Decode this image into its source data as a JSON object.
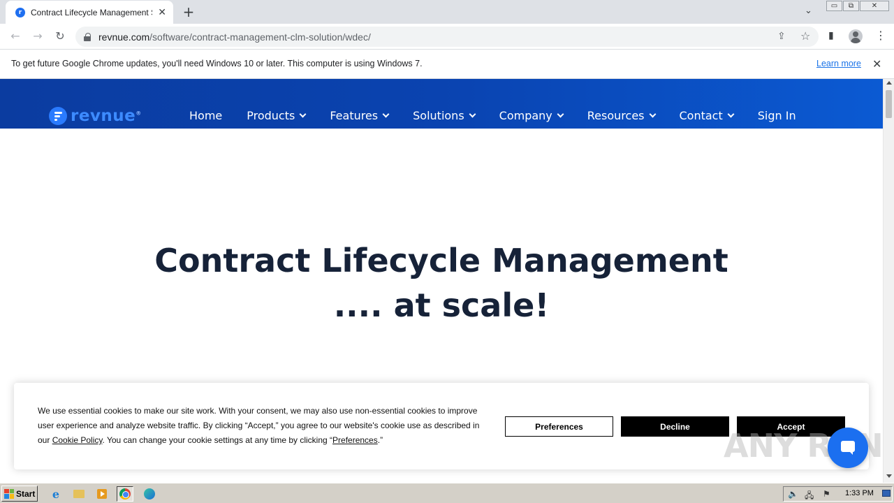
{
  "browser": {
    "tab_title": "Contract Lifecycle Management Soft",
    "favicon_glyph": "r",
    "new_tab_glyph": "+",
    "tab_close_glyph": "✕",
    "tab_search_glyph": "⌄",
    "window_controls": [
      "▭",
      "⧉",
      "✕"
    ],
    "url_host": "revnue.com",
    "url_path": "/software/contract-management-clm-solution/wdec/",
    "back_glyph": "←",
    "forward_glyph": "→",
    "reload_glyph": "↻",
    "share_glyph": "⇪",
    "star_glyph": "☆",
    "sidepanel_glyph": "▮",
    "menu_glyph": "⋮"
  },
  "infobar": {
    "message": "To get future Google Chrome updates, you'll need Windows 10 or later. This computer is using Windows 7.",
    "link": "Learn more",
    "close_glyph": "✕"
  },
  "site": {
    "logo_text": "revnue",
    "logo_mark": "®",
    "nav": [
      {
        "label": "Home",
        "dropdown": false
      },
      {
        "label": "Products",
        "dropdown": true
      },
      {
        "label": "Features",
        "dropdown": true
      },
      {
        "label": "Solutions",
        "dropdown": true
      },
      {
        "label": "Company",
        "dropdown": true
      },
      {
        "label": "Resources",
        "dropdown": true
      },
      {
        "label": "Contact",
        "dropdown": true
      },
      {
        "label": "Sign In",
        "dropdown": false
      }
    ],
    "hero_line1": "Contract Lifecycle Management",
    "hero_line2": ".... at scale!"
  },
  "cookie": {
    "text_1": "We use essential cookies to make our site work. With your consent, we may also use non-essential cookies to improve user experience and analyze website traffic. By clicking “Accept,” you agree to our website's cookie use as described in our ",
    "policy_link": "Cookie Policy",
    "text_2": ". You can change your cookie settings at any time by clicking “",
    "prefs_link": "Preferences",
    "text_3": ".”",
    "preferences_label": "Preferences",
    "decline_label": "Decline",
    "accept_label": "Accept"
  },
  "watermark": "ANY RUN",
  "taskbar": {
    "start_label": "Start",
    "ie_glyph": "e",
    "clock": "1:33 PM",
    "tray_glyphs": [
      "🔈",
      "🖧",
      "⚑"
    ]
  },
  "colors": {
    "header_start": "#0b3ca0",
    "header_end": "#0b5ad3",
    "hero_text": "#162238",
    "accent": "#1b6ff0"
  }
}
